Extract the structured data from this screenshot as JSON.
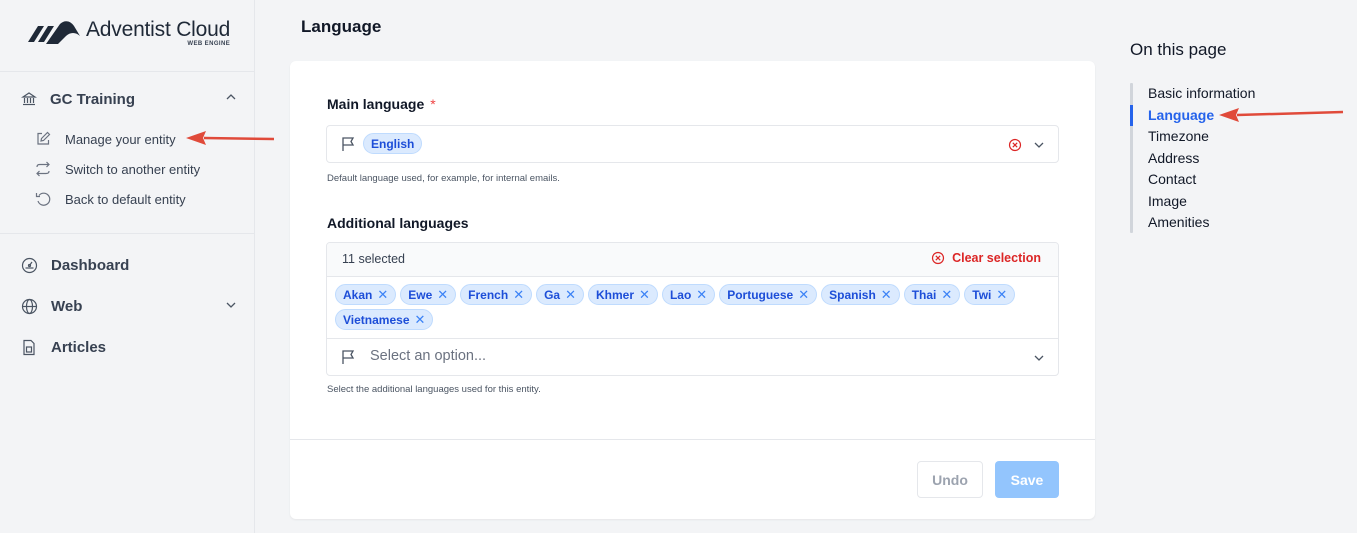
{
  "brand": {
    "name": "Adventist Cloud",
    "sub": "WEB ENGINE"
  },
  "sidebar": {
    "group": {
      "label": "GC Training"
    },
    "subitems": [
      {
        "label": "Manage your entity",
        "icon": "edit-icon"
      },
      {
        "label": "Switch to another entity",
        "icon": "switch-icon"
      },
      {
        "label": "Back to default entity",
        "icon": "undo-icon"
      }
    ],
    "items": [
      {
        "label": "Dashboard",
        "icon": "dashboard-icon"
      },
      {
        "label": "Web",
        "icon": "globe-icon"
      },
      {
        "label": "Articles",
        "icon": "document-icon"
      }
    ]
  },
  "page": {
    "title": "Language"
  },
  "form": {
    "main_language": {
      "label": "Main language",
      "required_mark": "*",
      "value": "English",
      "help": "Default language used, for example, for internal emails."
    },
    "additional_languages": {
      "label": "Additional languages",
      "selected_count": "11 selected",
      "clear_label": "Clear selection",
      "chips": [
        "Akan",
        "Ewe",
        "French",
        "Ga",
        "Khmer",
        "Lao",
        "Portuguese",
        "Spanish",
        "Thai",
        "Twi",
        "Vietnamese"
      ],
      "placeholder": "Select an option...",
      "help": "Select the additional languages used for this entity."
    },
    "undo_label": "Undo",
    "save_label": "Save"
  },
  "toc": {
    "title": "On this page",
    "items": [
      "Basic information",
      "Language",
      "Timezone",
      "Address",
      "Contact",
      "Image",
      "Amenities"
    ],
    "active": "Language"
  },
  "colors": {
    "accent": "#2563eb",
    "danger": "#dc2626",
    "annotation_arrow": "#e04a3a"
  }
}
